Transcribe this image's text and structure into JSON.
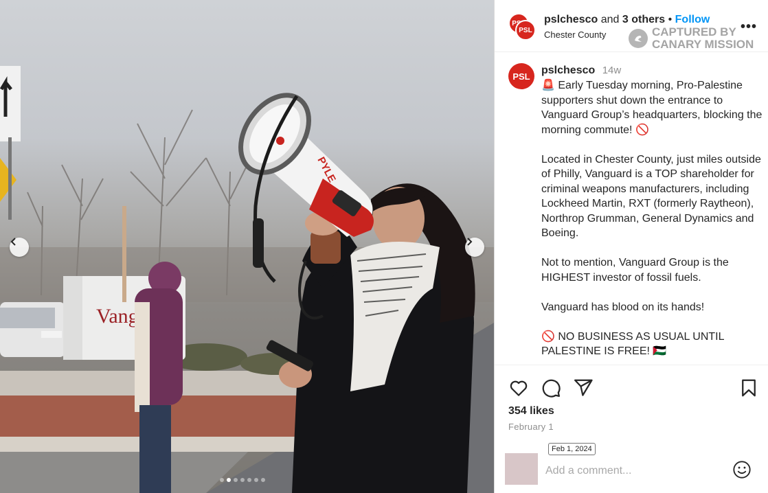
{
  "header": {
    "username": "pslchesco",
    "and_text": "and",
    "others_text": "3 others",
    "separator": "•",
    "follow_label": "Follow",
    "location": "Chester County",
    "more_label": "•••",
    "avatar_text": "PSL"
  },
  "watermark": {
    "line1": "CAPTURED BY",
    "line2": "CANARY MISSION"
  },
  "photo": {
    "megaphone_brand": "PYLE",
    "sign_text": "Vang",
    "slide_count": 7,
    "active_slide": 2
  },
  "caption": {
    "username": "pslchesco",
    "time": "14w",
    "paragraphs": [
      "🚨 Early Tuesday morning, Pro-Palestine supporters shut down the entrance to Vanguard Group’s headquarters, blocking the morning commute! 🚫",
      "Located in Chester County, just miles outside of Philly, Vanguard is a TOP shareholder for criminal weapons manufacturers, including Lockheed Martin, RXT (formerly Raytheon), Northrop Grumman, General Dynamics and Boeing.",
      "Not to mention, Vanguard Group is the HIGHEST investor of fossil fuels.",
      "Vanguard has blood on its hands!",
      "🚫 NO BUSINESS AS USUAL UNTIL PALESTINE IS FREE! 🇵🇸"
    ]
  },
  "actions": {
    "like_icon": "heart-icon",
    "comment_icon": "comment-icon",
    "share_icon": "paper-plane-icon",
    "save_icon": "bookmark-icon"
  },
  "likes_text": "354 likes",
  "date_text": "February 1",
  "date_tooltip": "Feb 1, 2024",
  "comment": {
    "placeholder": "Add a comment..."
  },
  "colors": {
    "brand_red": "#d7261e",
    "follow_blue": "#0095f6"
  }
}
